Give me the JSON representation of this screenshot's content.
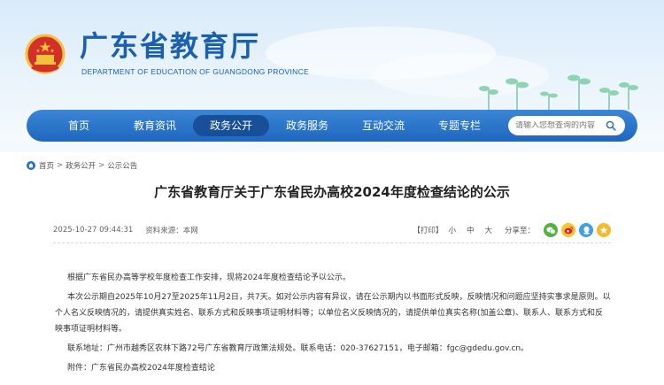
{
  "site": {
    "title": "广东省教育厅",
    "subtitle": "DEPARTMENT OF EDUCATION OF GUANGDONG PROVINCE"
  },
  "nav": {
    "items": [
      {
        "label": "首页"
      },
      {
        "label": "教育资讯"
      },
      {
        "label": "政务公开",
        "active": true
      },
      {
        "label": "政务服务"
      },
      {
        "label": "互动交流"
      },
      {
        "label": "专题专栏"
      }
    ],
    "search_placeholder": "请输入您想查询的内容"
  },
  "breadcrumb": {
    "items": [
      "首页",
      "政务公开",
      "公示公告"
    ],
    "separator": ">"
  },
  "article": {
    "title": "广东省教育厅关于广东省民办高校2024年度检查结论的公示",
    "date": "2025-10-27 09:44:31",
    "source": "资料来源：本网",
    "print_label": "【打印】",
    "font_sizes": [
      "小",
      "中",
      "大"
    ],
    "share_label": "分享至：",
    "paragraphs": [
      "根据广东省民办高等学校年度检查工作安排，现将2024年度检查结论予以公示。",
      "本次公示期自2025年10月27至2025年11月2日，共7天。如对公示内容有异议，请在公示期内以书面形式反映，反映情况和问题应坚持实事求是原则。以个人名义反映情况的，请提供真实姓名、联系方式和反映事项证明材料等；以单位名义反映情况的，请提供单位真实名称(加盖公章)、联系人、联系方式和反映事项证明材料等。",
      "联系地址：广州市越秀区农林下路72号广东省教育厅政策法规处。联系电话：020-37627151，电子邮箱：fgc@gdedu.gov.cn。",
      "附件：广东省民办高校2024年度检查结论"
    ]
  },
  "colors": {
    "brand": "#1b5fb0",
    "nav_bg": "#2a74c9",
    "nav_active": "#174f99"
  },
  "icons": {
    "emblem": "national-emblem-icon",
    "search": "search-icon",
    "home": "home-icon",
    "share": [
      "wechat-icon",
      "weibo-icon",
      "qq-icon",
      "qzone-icon"
    ]
  }
}
